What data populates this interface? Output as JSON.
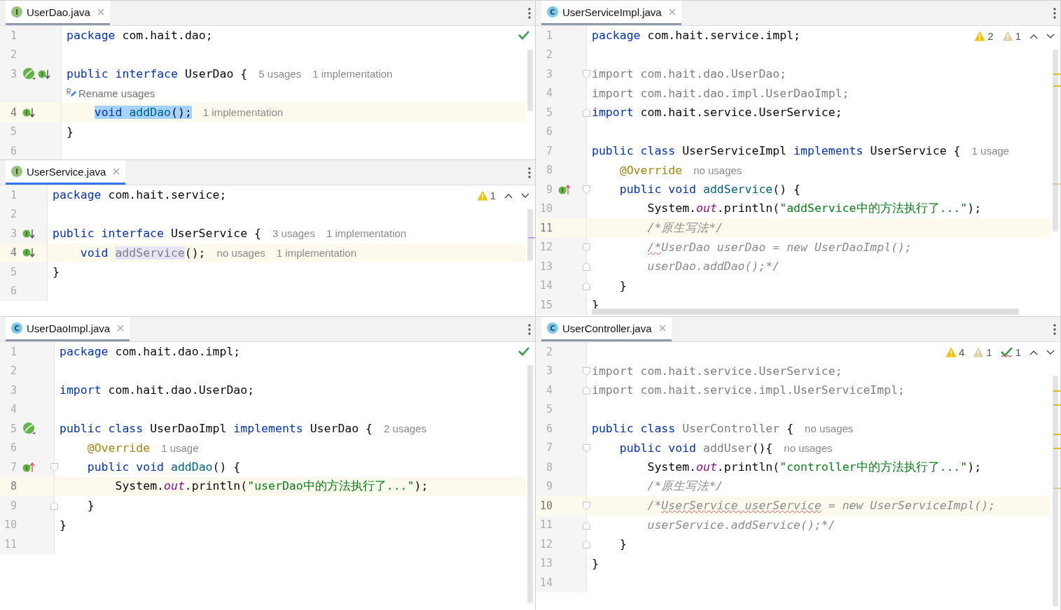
{
  "columns": [
    [
      {
        "tab": {
          "name": "UserDao.java",
          "icon": "I",
          "kind": "interface",
          "active": false
        },
        "status": [
          {
            "kind": "ok"
          }
        ],
        "nav": false,
        "lines": [
          {
            "kind": "code",
            "number": "1",
            "tokens": [
              {
                "kind": "keyword",
                "text": "package"
              },
              {
                "kind": "plain",
                "text": " com.hait.dao;"
              }
            ]
          },
          {
            "kind": "code",
            "number": "2"
          },
          {
            "kind": "code",
            "number": "3",
            "gutter_icons": [
              {
                "kind": "leaf"
              },
              {
                "kind": "implemented"
              }
            ],
            "tokens": [
              {
                "kind": "keyword",
                "text": "public"
              },
              {
                "kind": "keyword",
                "text": " interface"
              },
              {
                "kind": "plain",
                "text": " UserDao {"
              }
            ],
            "hints": [
              "5 usages",
              "1 implementation"
            ]
          },
          {
            "kind": "action",
            "text": "Rename usages"
          },
          {
            "kind": "code",
            "number": "4",
            "current": true,
            "indent": {
              "kind": "member"
            },
            "gutter_icons": [
              {
                "kind": "implemented"
              }
            ],
            "tokens": [
              {
                "kind": "keyword",
                "text": "void",
                "selected": true
              },
              {
                "kind": "method",
                "text": " addDao",
                "selected": true
              },
              {
                "kind": "plain",
                "text": "();",
                "selected": true
              }
            ],
            "hints": [
              "1 implementation"
            ]
          },
          {
            "kind": "code",
            "number": "5",
            "tokens": [
              {
                "kind": "plain",
                "text": "}"
              }
            ]
          },
          {
            "kind": "code",
            "number": "6"
          }
        ]
      },
      {
        "tab": {
          "name": "UserService.java",
          "icon": "I",
          "kind": "interface",
          "active": true
        },
        "status": [
          {
            "kind": "warning",
            "count": "1"
          }
        ],
        "nav": true,
        "lines": [
          {
            "number": "1",
            "tokens": [
              {
                "kind": "keyword",
                "text": "package"
              },
              {
                "kind": "plain",
                "text": " com.hait.service;"
              }
            ]
          },
          {
            "number": "2"
          },
          {
            "number": "3",
            "gutter_icons": [
              {
                "kind": "implemented"
              }
            ],
            "tokens": [
              {
                "kind": "keyword",
                "text": "public"
              },
              {
                "kind": "keyword",
                "text": " interface"
              },
              {
                "kind": "plain",
                "text": " UserService {"
              }
            ],
            "hints": [
              "3 usages",
              "1 implementation"
            ]
          },
          {
            "number": "4",
            "current": true,
            "indent": {
              "kind": "member"
            },
            "gutter_icons": [
              {
                "kind": "implemented"
              }
            ],
            "tokens": [
              {
                "kind": "keyword",
                "text": "void "
              },
              {
                "kind": "unused",
                "text": "addService",
                "usage_highlight": true
              },
              {
                "kind": "plain",
                "text": "();"
              }
            ],
            "hints": [
              "no usages",
              "1 implementation"
            ]
          },
          {
            "number": "5",
            "tokens": [
              {
                "kind": "plain",
                "text": "}"
              }
            ]
          },
          {
            "number": "6"
          }
        ]
      },
      {
        "tab": {
          "name": "UserDaoImpl.java",
          "icon": "C",
          "kind": "class",
          "active": false
        },
        "status": [
          {
            "kind": "ok"
          }
        ],
        "nav": false,
        "lines": [
          {
            "number": "1",
            "tokens": [
              {
                "kind": "keyword",
                "text": "package"
              },
              {
                "kind": "plain",
                "text": " com.hait.dao.impl;"
              }
            ]
          },
          {
            "number": "2"
          },
          {
            "number": "3",
            "tokens": [
              {
                "kind": "keyword",
                "text": "import"
              },
              {
                "kind": "plain",
                "text": " com.hait.dao.UserDao;"
              }
            ]
          },
          {
            "number": "4"
          },
          {
            "number": "5",
            "gutter_icons": [
              {
                "kind": "leaf"
              }
            ],
            "tokens": [
              {
                "kind": "keyword",
                "text": "public"
              },
              {
                "kind": "keyword",
                "text": " class"
              },
              {
                "kind": "plain",
                "text": " UserDaoImpl"
              },
              {
                "kind": "keyword",
                "text": " implements"
              },
              {
                "kind": "plain",
                "text": " UserDao {"
              }
            ],
            "hints": [
              "2 usages"
            ]
          },
          {
            "number": "6",
            "indent": {
              "kind": "member"
            },
            "tokens": [
              {
                "kind": "annotation",
                "text": "@Override"
              }
            ],
            "hints": [
              "1 usage"
            ]
          },
          {
            "number": "7",
            "indent": {
              "kind": "member"
            },
            "fold_start": true,
            "gutter_icons": [
              {
                "kind": "implementing"
              }
            ],
            "tokens": [
              {
                "kind": "keyword",
                "text": "public"
              },
              {
                "kind": "keyword",
                "text": " void"
              },
              {
                "kind": "method",
                "text": " addDao"
              },
              {
                "kind": "plain",
                "text": "() {"
              }
            ]
          },
          {
            "number": "8",
            "current": true,
            "indent": {
              "kind": "body"
            },
            "tokens": [
              {
                "kind": "plain",
                "text": "System."
              },
              {
                "kind": "field",
                "text": "out"
              },
              {
                "kind": "plain",
                "text": ".println("
              },
              {
                "kind": "string",
                "text": "\"userDao中的方法执行了...\""
              },
              {
                "kind": "plain",
                "text": ");"
              }
            ]
          },
          {
            "number": "9",
            "indent": {
              "kind": "member"
            },
            "fold_end": true,
            "tokens": [
              {
                "kind": "plain",
                "text": "}"
              }
            ]
          },
          {
            "number": "10",
            "tokens": [
              {
                "kind": "plain",
                "text": "}"
              }
            ]
          },
          {
            "number": "11"
          }
        ]
      }
    ],
    [
      {
        "tab": {
          "name": "UserServiceImpl.java",
          "icon": "C",
          "kind": "class",
          "active": false
        },
        "status": [
          {
            "kind": "warning",
            "count": "2"
          },
          {
            "kind": "weak",
            "count": "1"
          }
        ],
        "nav": true,
        "lines": [
          {
            "number": "1",
            "tokens": [
              {
                "kind": "keyword",
                "text": "package"
              },
              {
                "kind": "plain",
                "text": " com.hait.service.impl;"
              }
            ]
          },
          {
            "number": "2"
          },
          {
            "number": "3",
            "fold_start": true,
            "tokens": [
              {
                "kind": "unused",
                "text": "import com.hait.dao.UserDao;"
              }
            ]
          },
          {
            "number": "4",
            "tokens": [
              {
                "kind": "unused",
                "text": "import com.hait.dao.impl.UserDaoImpl;"
              }
            ]
          },
          {
            "number": "5",
            "fold_end": true,
            "tokens": [
              {
                "kind": "keyword",
                "text": "import"
              },
              {
                "kind": "plain",
                "text": " com.hait.service.UserService;"
              }
            ]
          },
          {
            "number": "6"
          },
          {
            "number": "7",
            "tokens": [
              {
                "kind": "keyword",
                "text": "public"
              },
              {
                "kind": "keyword",
                "text": " class"
              },
              {
                "kind": "plain",
                "text": " UserServiceImpl"
              },
              {
                "kind": "keyword",
                "text": " implements"
              },
              {
                "kind": "plain",
                "text": " UserService {"
              }
            ],
            "hints": [
              "1 usage"
            ]
          },
          {
            "number": "8",
            "indent": {
              "kind": "member"
            },
            "tokens": [
              {
                "kind": "annotation",
                "text": "@Override"
              }
            ],
            "hints": [
              "no usages"
            ]
          },
          {
            "number": "9",
            "indent": {
              "kind": "member"
            },
            "fold_start": true,
            "gutter_icons": [
              {
                "kind": "implementing"
              }
            ],
            "tokens": [
              {
                "kind": "keyword",
                "text": "public"
              },
              {
                "kind": "keyword",
                "text": " void"
              },
              {
                "kind": "method",
                "text": " addService"
              },
              {
                "kind": "plain",
                "text": "() {"
              }
            ]
          },
          {
            "number": "10",
            "indent": {
              "kind": "body"
            },
            "tokens": [
              {
                "kind": "plain",
                "text": "System."
              },
              {
                "kind": "field",
                "text": "out"
              },
              {
                "kind": "plain",
                "text": ".println("
              },
              {
                "kind": "string",
                "text": "\"addService中的方法执行了...\""
              },
              {
                "kind": "plain",
                "text": ");"
              }
            ]
          },
          {
            "number": "11",
            "current": true,
            "indent": {
              "kind": "body"
            },
            "tokens": [
              {
                "kind": "comment",
                "text": "/*原生写法*/"
              }
            ]
          },
          {
            "number": "12",
            "indent": {
              "kind": "body"
            },
            "fold_start": true,
            "tokens": [
              {
                "kind": "comment",
                "text": "/*",
                "typo": true
              },
              {
                "kind": "comment",
                "text": "UserDao userDao = new UserDaoImpl();"
              }
            ]
          },
          {
            "number": "13",
            "indent": {
              "kind": "body"
            },
            "fold_end": true,
            "tokens": [
              {
                "kind": "comment",
                "text": "userDao.addDao();*/"
              }
            ]
          },
          {
            "number": "14",
            "indent": {
              "kind": "member"
            },
            "fold_end": true,
            "tokens": [
              {
                "kind": "plain",
                "text": "}"
              }
            ]
          },
          {
            "number": "15",
            "tokens": [
              {
                "kind": "plain",
                "text": "}"
              }
            ]
          }
        ]
      },
      {
        "tab": {
          "name": "UserController.java",
          "icon": "C",
          "kind": "class",
          "active": false
        },
        "status": [
          {
            "kind": "warning",
            "count": "4"
          },
          {
            "kind": "weak",
            "count": "1"
          },
          {
            "kind": "typo",
            "count": "1"
          }
        ],
        "nav": true,
        "lines": [
          {
            "number": "2"
          },
          {
            "number": "3",
            "fold_start": true,
            "tokens": [
              {
                "kind": "unused",
                "text": "import com.hait.service.UserService;"
              }
            ]
          },
          {
            "number": "4",
            "fold_end": true,
            "tokens": [
              {
                "kind": "unused",
                "text": "import com.hait.service.impl.UserServiceImpl;"
              }
            ]
          },
          {
            "number": "5"
          },
          {
            "number": "6",
            "tokens": [
              {
                "kind": "keyword",
                "text": "public"
              },
              {
                "kind": "keyword",
                "text": " class"
              },
              {
                "kind": "unused",
                "text": " UserController"
              },
              {
                "kind": "plain",
                "text": " {"
              }
            ],
            "hints": [
              "no usages"
            ]
          },
          {
            "number": "7",
            "indent": {
              "kind": "member"
            },
            "fold_start": true,
            "tokens": [
              {
                "kind": "keyword",
                "text": "public"
              },
              {
                "kind": "keyword",
                "text": " void"
              },
              {
                "kind": "unused",
                "text": " addUser"
              },
              {
                "kind": "plain",
                "text": "(){"
              }
            ],
            "hints": [
              "no usages"
            ]
          },
          {
            "number": "8",
            "indent": {
              "kind": "body"
            },
            "tokens": [
              {
                "kind": "plain",
                "text": "System."
              },
              {
                "kind": "field",
                "text": "out"
              },
              {
                "kind": "plain",
                "text": ".println("
              },
              {
                "kind": "string",
                "text": "\"controller中的方法执行了...\""
              },
              {
                "kind": "plain",
                "text": ");"
              }
            ]
          },
          {
            "number": "9",
            "indent": {
              "kind": "body"
            },
            "tokens": [
              {
                "kind": "comment",
                "text": "/*原生写法*/"
              }
            ]
          },
          {
            "number": "10",
            "current": true,
            "indent": {
              "kind": "body"
            },
            "fold_start": true,
            "tokens": [
              {
                "kind": "comment",
                "text": "/*"
              },
              {
                "kind": "comment",
                "text": "UserService userService",
                "typo": true
              },
              {
                "kind": "comment",
                "text": " = new UserServiceImpl();"
              }
            ]
          },
          {
            "number": "11",
            "indent": {
              "kind": "body"
            },
            "fold_end": true,
            "tokens": [
              {
                "kind": "comment",
                "text": "userService.addService();*/"
              }
            ]
          },
          {
            "number": "12",
            "indent": {
              "kind": "member"
            },
            "fold_end": true,
            "tokens": [
              {
                "kind": "plain",
                "text": "}"
              }
            ]
          },
          {
            "number": "13",
            "tokens": [
              {
                "kind": "plain",
                "text": "}"
              }
            ]
          },
          {
            "number": "14"
          }
        ]
      }
    ]
  ]
}
